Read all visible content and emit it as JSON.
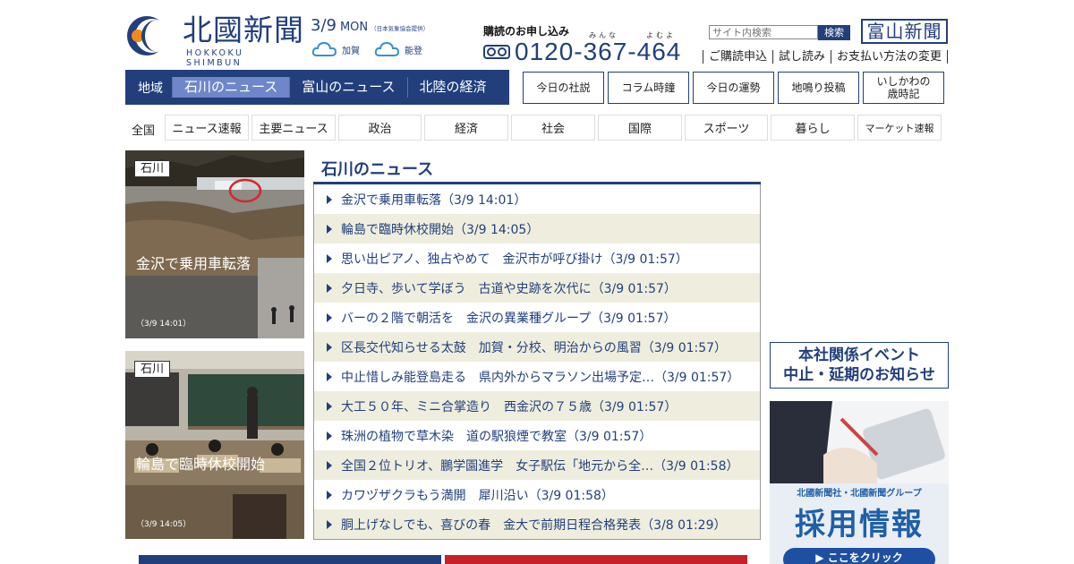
{
  "header": {
    "logo_jp": "北國新聞",
    "logo_en": "HOKKOKU SHIMBUN",
    "date": "3/9",
    "weekday": "MON",
    "weather_note": "（日本気象協会提供）",
    "weather": [
      {
        "area": "加賀",
        "icon": "cloud-icon"
      },
      {
        "area": "能登",
        "icon": "cloud-icon"
      }
    ],
    "subscribe_title": "購読のお申し込み",
    "ruby_1": "みんな",
    "ruby_2": "よむよ",
    "phone": "0120-367-464",
    "search_placeholder": "サイト内検索",
    "search_button": "検索",
    "toyama_logo": "富山新聞",
    "top_links": [
      "ご購読申込",
      "試し読み",
      "お支払い方法の変更"
    ]
  },
  "region_nav": {
    "label": "地域",
    "tabs": [
      "石川のニュース",
      "富山のニュース",
      "北陸の経済"
    ],
    "active": 0
  },
  "column_buttons": [
    "今日の社説",
    "コラム時鐘",
    "今日の運勢",
    "地鳴り投稿",
    "いしかわの",
    "歳時記"
  ],
  "category_nav": {
    "label": "全国",
    "items": [
      "ニュース速報",
      "主要ニュース",
      "政治",
      "経済",
      "社会",
      "国際",
      "スポーツ",
      "暮らし",
      "マーケット速報"
    ]
  },
  "photos": [
    {
      "tag": "石川",
      "caption": "金沢で乗用車転落",
      "time": "（3/9 14:01）"
    },
    {
      "tag": "石川",
      "caption": "輪島で臨時休校開始",
      "time": "（3/9 14:05）"
    }
  ],
  "news": {
    "title": "石川のニュース",
    "items": [
      "金沢で乗用車転落（3/9 14:01）",
      "輪島で臨時休校開始（3/9 14:05）",
      "思い出ピアノ、独占やめて　金沢市が呼び掛け（3/9 01:57）",
      "夕日寺、歩いて学ぼう　古道や史跡を次代に（3/9 01:57）",
      "バーの２階で朝活を　金沢の異業種グループ（3/9 01:57）",
      "区長交代知らせる太鼓　加賀・分校、明治からの風習（3/9 01:57）",
      "中止惜しみ能登島走る　県内外からマラソン出場予定…（3/9 01:57）",
      "大工５０年、ミニ合掌造り　西金沢の７５歳（3/9 01:57）",
      "珠洲の植物で草木染　道の駅狼煙で教室（3/9 01:57）",
      "全国２位トリオ、鵬学園進学　女子駅伝「地元から全…（3/9 01:58）",
      "カワヅザクラもう満開　犀川沿い（3/9 01:58）",
      "胴上げなしでも、喜びの春　金大で前期日程合格発表（3/8 01:29）"
    ]
  },
  "banners": {
    "event_line1": "本社関係イベント",
    "event_line2": "中止・延期のお知らせ",
    "recruit_sub": "北國新聞社・北國新聞グループ",
    "recruit_big": "採用情報",
    "recruit_btn": "▶ ここをクリック"
  }
}
